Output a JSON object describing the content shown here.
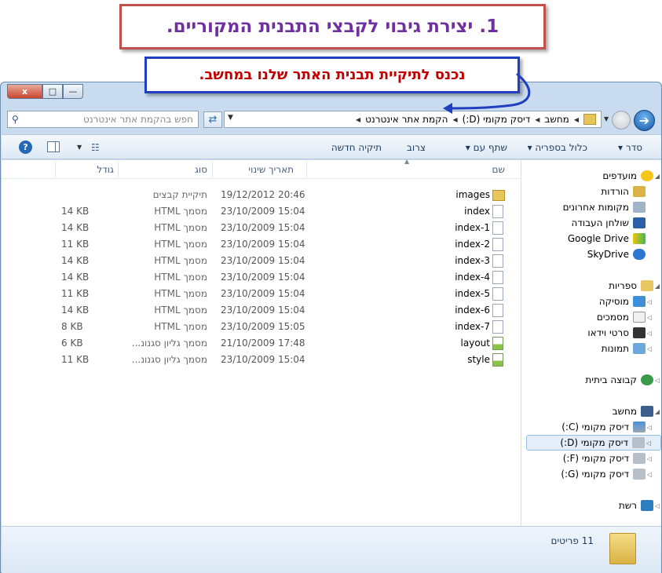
{
  "callouts": {
    "step": "1. יצירת גיבוי לקבצי התבנית המקוריים.",
    "note": "נכנס לתיקיית תבנית האתר שלנו במחשב."
  },
  "window": {
    "buttons": {
      "close": "x",
      "maximize": "□",
      "minimize": "—"
    }
  },
  "address": {
    "breadcrumbs": [
      "מחשב",
      "דיסק מקומי (D:)",
      "הקמת אתר אינטרנט"
    ],
    "search_placeholder": "חפש בהקמת אתר אינטרנט"
  },
  "toolbar": {
    "organize": "סדר",
    "include_in_library": "כלול בספריה",
    "share_with": "שתף עם",
    "burn": "צרוב",
    "new_folder": "תיקיה חדשה"
  },
  "columns": {
    "name": "שם",
    "date_modified": "תאריך שינוי",
    "type": "סוג",
    "size": "גודל"
  },
  "files": [
    {
      "name": "images",
      "date": "19/12/2012 20:46",
      "type": "תיקיית קבצים",
      "size": "",
      "icon": "folder"
    },
    {
      "name": "index",
      "date": "23/10/2009 15:04",
      "type": "מסמך HTML",
      "size": "14 KB",
      "icon": "doc"
    },
    {
      "name": "index-1",
      "date": "23/10/2009 15:04",
      "type": "מסמך HTML",
      "size": "14 KB",
      "icon": "doc"
    },
    {
      "name": "index-2",
      "date": "23/10/2009 15:04",
      "type": "מסמך HTML",
      "size": "11 KB",
      "icon": "doc"
    },
    {
      "name": "index-3",
      "date": "23/10/2009 15:04",
      "type": "מסמך HTML",
      "size": "14 KB",
      "icon": "doc"
    },
    {
      "name": "index-4",
      "date": "23/10/2009 15:04",
      "type": "מסמך HTML",
      "size": "14 KB",
      "icon": "doc"
    },
    {
      "name": "index-5",
      "date": "23/10/2009 15:04",
      "type": "מסמך HTML",
      "size": "11 KB",
      "icon": "doc"
    },
    {
      "name": "index-6",
      "date": "23/10/2009 15:04",
      "type": "מסמך HTML",
      "size": "14 KB",
      "icon": "doc"
    },
    {
      "name": "index-7",
      "date": "23/10/2009 15:05",
      "type": "מסמך HTML",
      "size": "8 KB",
      "icon": "doc"
    },
    {
      "name": "layout",
      "date": "21/10/2009 17:48",
      "type": "מסמך גליון סגנונ...",
      "size": "6 KB",
      "icon": "css"
    },
    {
      "name": "style",
      "date": "23/10/2009 15:04",
      "type": "מסמך גליון סגנונ...",
      "size": "11 KB",
      "icon": "css"
    }
  ],
  "navigation": {
    "favorites": {
      "label": "מועדפים",
      "items": [
        "הורדות",
        "מקומות אחרונים",
        "שולחן העבודה",
        "Google Drive",
        "SkyDrive"
      ]
    },
    "libraries": {
      "label": "ספריות",
      "items": [
        "מוסיקה",
        "מסמכים",
        "סרטי וידאו",
        "תמונות"
      ]
    },
    "homegroup": {
      "label": "קבוצה ביתית"
    },
    "computer": {
      "label": "מחשב",
      "items": [
        "דיסק מקומי (C:)",
        "דיסק מקומי (D:)",
        "דיסק מקומי (F:)",
        "דיסק מקומי (G:)"
      ]
    },
    "network": {
      "label": "רשת"
    }
  },
  "status": {
    "item_count": "11 פריטים"
  },
  "colors": {
    "callout1_border": "#c0504d",
    "callout1_text": "#7030a0",
    "callout2_border": "#1f3fbf",
    "callout2_text": "#c00000",
    "window_frame": "#c9dbef",
    "selected_nav": "#e4eefa"
  }
}
